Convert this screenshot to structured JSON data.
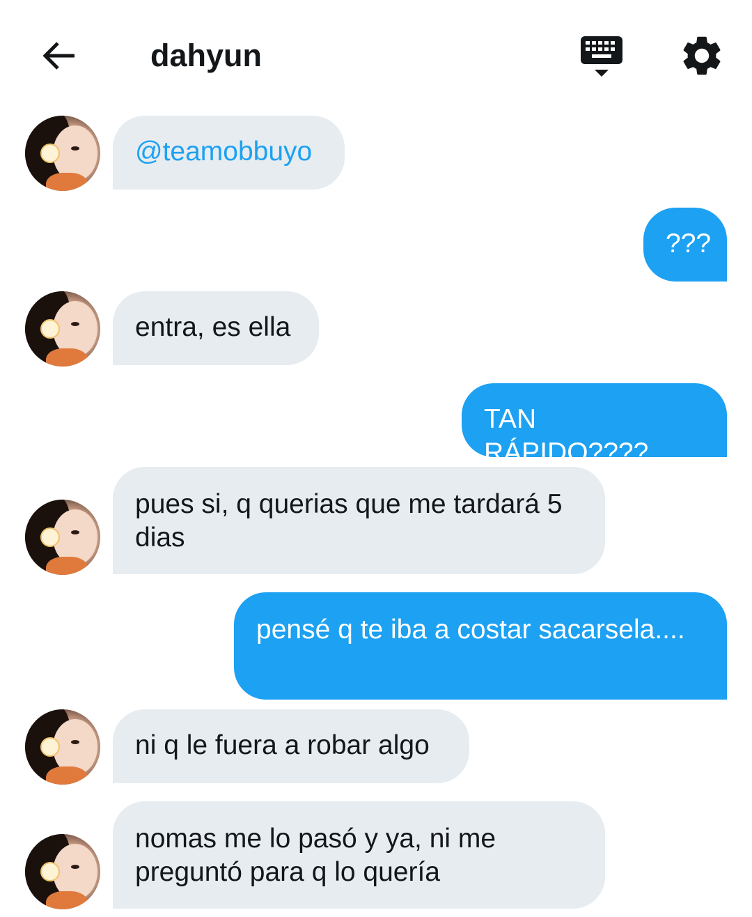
{
  "header": {
    "title": "dahyun",
    "back_icon": "arrow-left-icon",
    "keyboard_icon": "keyboard-icon",
    "settings_icon": "gear-icon"
  },
  "colors": {
    "incoming_bubble": "#e6ecf0",
    "outgoing_bubble": "#1da1f2",
    "mention": "#1da1f2"
  },
  "messages": [
    {
      "direction": "in",
      "text": "@teamobbuyo"
    },
    {
      "direction": "out",
      "text": "???"
    },
    {
      "direction": "in",
      "text": "entra, es ella"
    },
    {
      "direction": "out",
      "text": "TAN RÁPIDO????"
    },
    {
      "direction": "in",
      "text": "pues si, q querias que me tardará 5 dias"
    },
    {
      "direction": "out",
      "text": "pensé q te iba a costar sacarsela...."
    },
    {
      "direction": "in",
      "text": "ni q le fuera a robar algo"
    },
    {
      "direction": "in",
      "text": "nomas me lo pasó y ya, ni me preguntó para q lo quería"
    }
  ]
}
